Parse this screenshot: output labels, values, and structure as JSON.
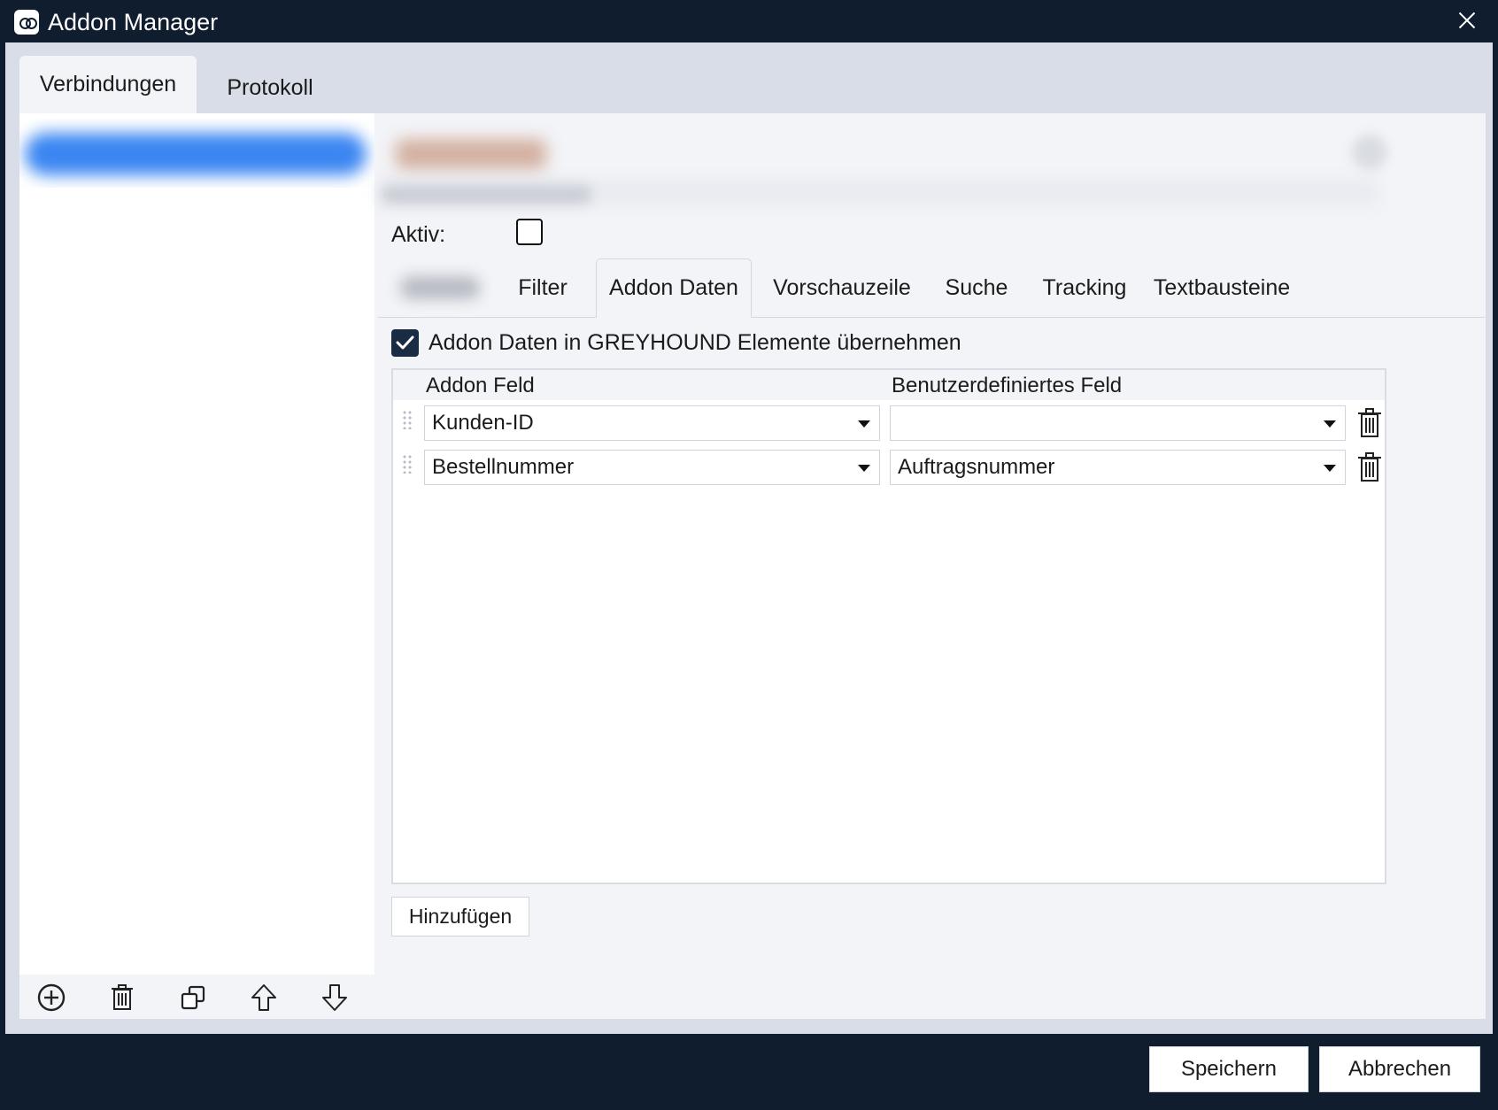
{
  "window": {
    "title": "Addon Manager"
  },
  "main_tabs": [
    {
      "label": "Verbindungen"
    },
    {
      "label": "Protokoll"
    }
  ],
  "detail": {
    "aktiv_label": "Aktiv:",
    "tabs": [
      {
        "label": "Filter"
      },
      {
        "label": "Addon Daten"
      },
      {
        "label": "Vorschauzeile"
      },
      {
        "label": "Suche"
      },
      {
        "label": "Tracking"
      },
      {
        "label": "Textbausteine"
      }
    ],
    "transfer_checkbox_label": "Addon Daten in GREYHOUND Elemente übernehmen",
    "grid": {
      "col_addon": "Addon Feld",
      "col_custom": "Benutzerdefiniertes Feld",
      "rows": [
        {
          "addon": "Kunden-ID",
          "custom": ""
        },
        {
          "addon": "Bestellnummer",
          "custom": "Auftragsnummer"
        }
      ]
    },
    "add_button": "Hinzufügen"
  },
  "footer": {
    "save": "Speichern",
    "cancel": "Abbrechen"
  },
  "icons": {
    "list_toolbar": [
      "plus-circle-icon",
      "trash-icon",
      "duplicate-icon",
      "arrow-up-icon",
      "arrow-down-icon"
    ]
  },
  "colors": {
    "titlebar_bg": "#0f1d2e",
    "selection_blue": "#3b86f2",
    "checkbox_fill": "#1a2b44"
  }
}
